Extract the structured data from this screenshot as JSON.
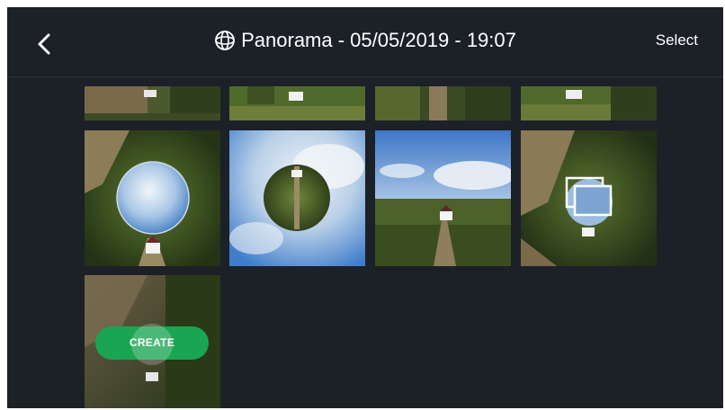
{
  "header": {
    "back_icon": "chevron-left-icon",
    "panorama_icon": "globe-icon",
    "title": "Panorama - 05/05/2019 - 19:07",
    "select_label": "Select"
  },
  "gallery": {
    "create_label": "CREATE",
    "stack_icon": "stacked-photos-icon"
  },
  "colors": {
    "background": "#1c2027",
    "accent_green": "#1aa552",
    "text": "#ffffff"
  }
}
